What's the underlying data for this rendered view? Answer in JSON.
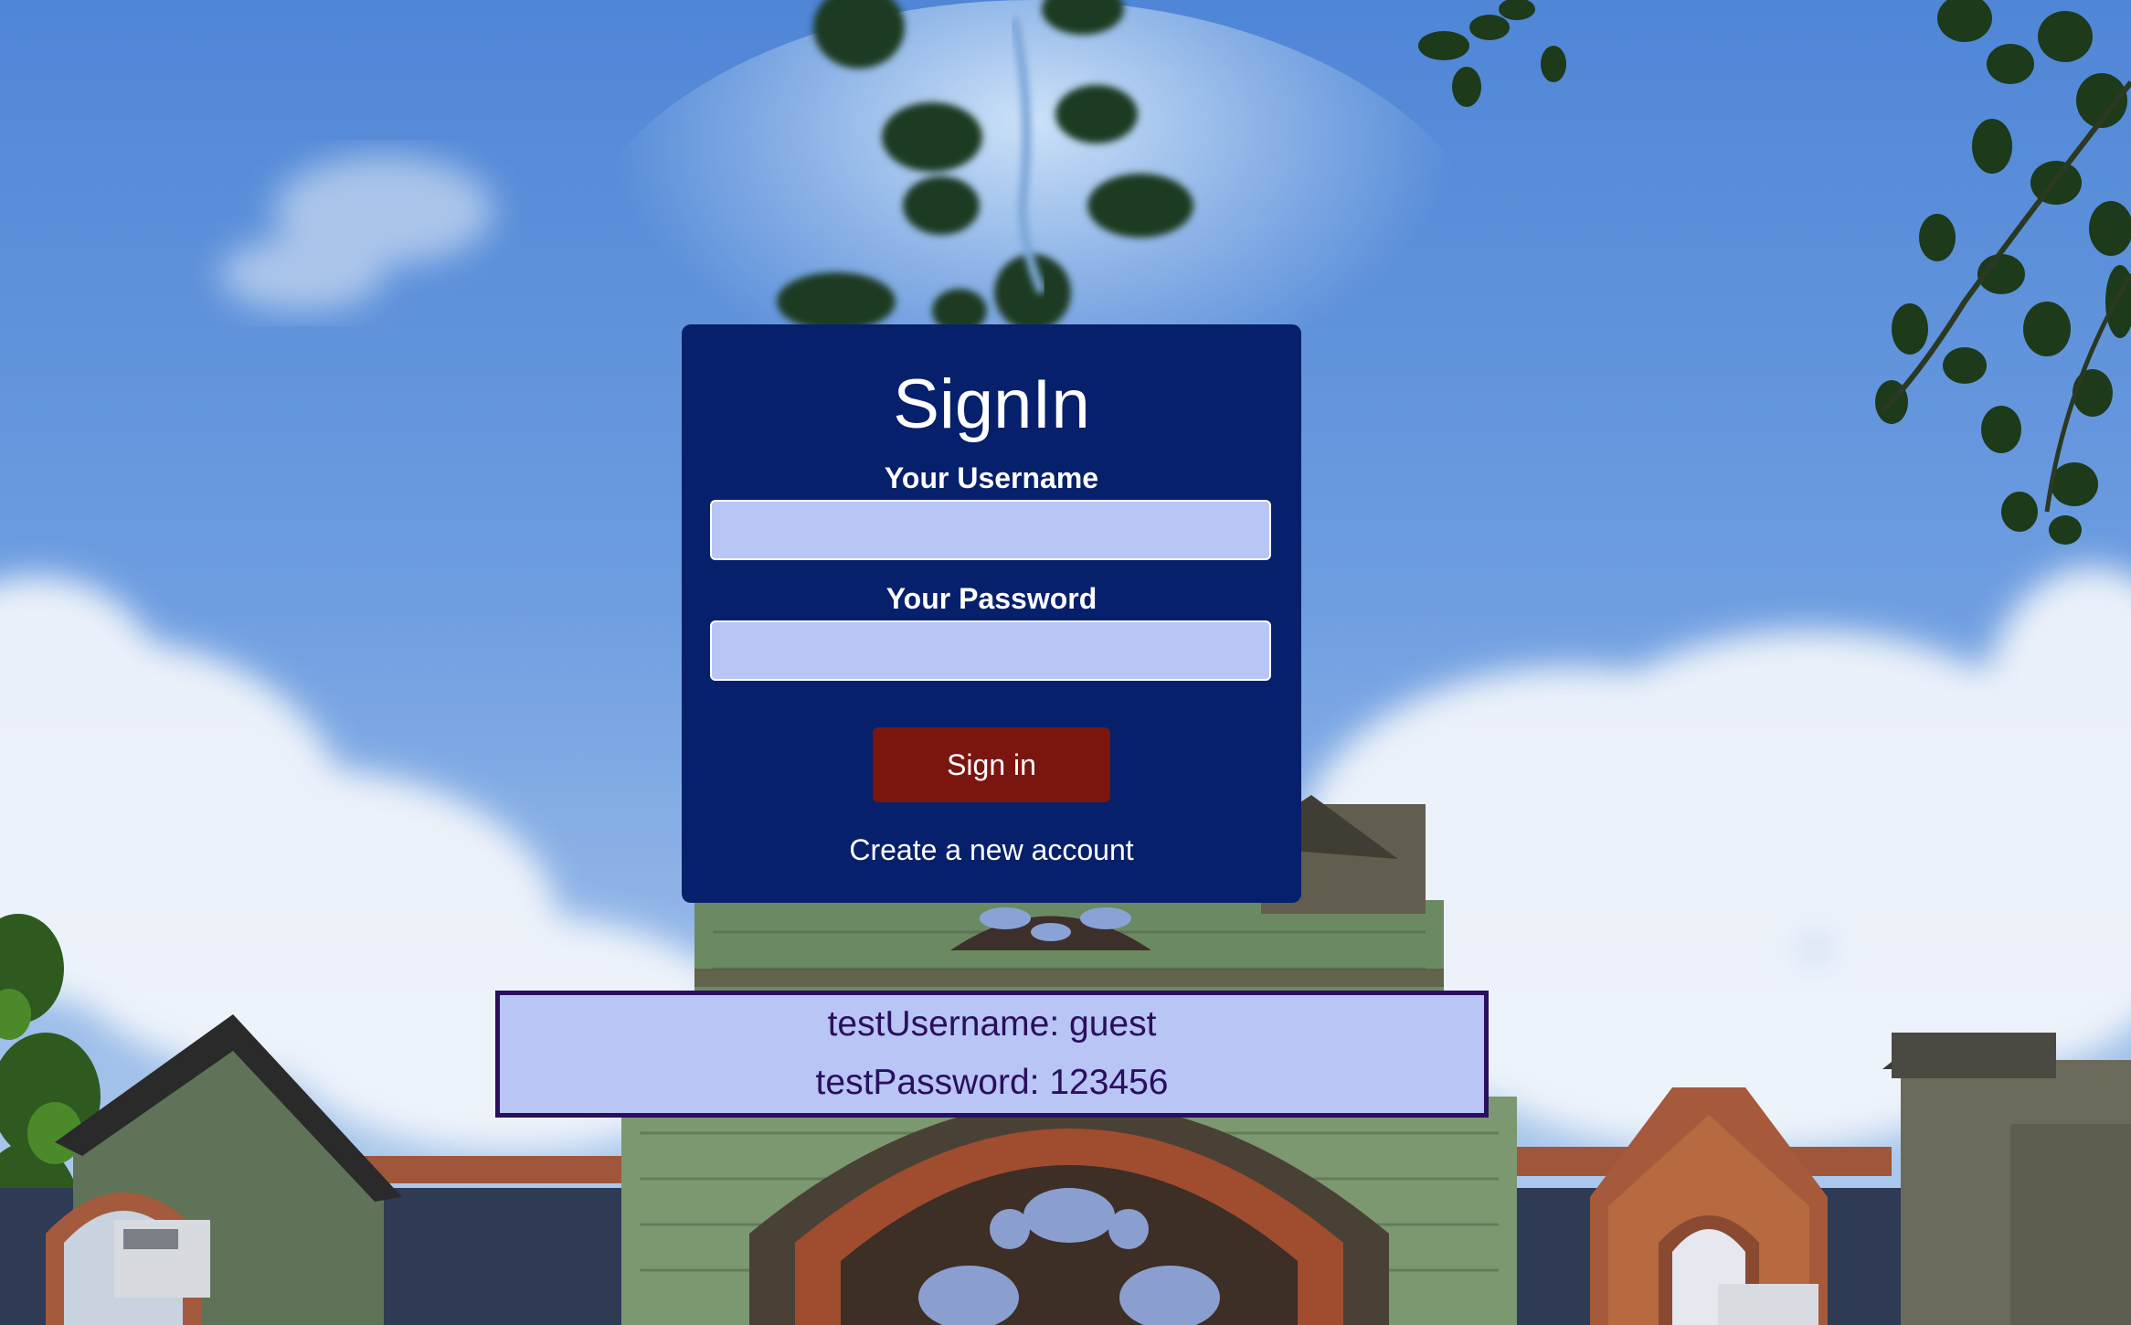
{
  "signin": {
    "title": "SignIn",
    "username_label": "Your Username",
    "username_value": "",
    "password_label": "Your Password",
    "password_value": "",
    "submit_label": "Sign in",
    "create_account_label": "Create a new account"
  },
  "test_credentials": {
    "username_line": "testUsername: guest",
    "password_line": "testPassword: 123456"
  },
  "colors": {
    "card_background": "#06206b",
    "input_background": "#b8c5f5",
    "submit_button": "#7b1510",
    "credentials_background": "#b8c5f5",
    "credentials_text": "#2a0f5e"
  }
}
